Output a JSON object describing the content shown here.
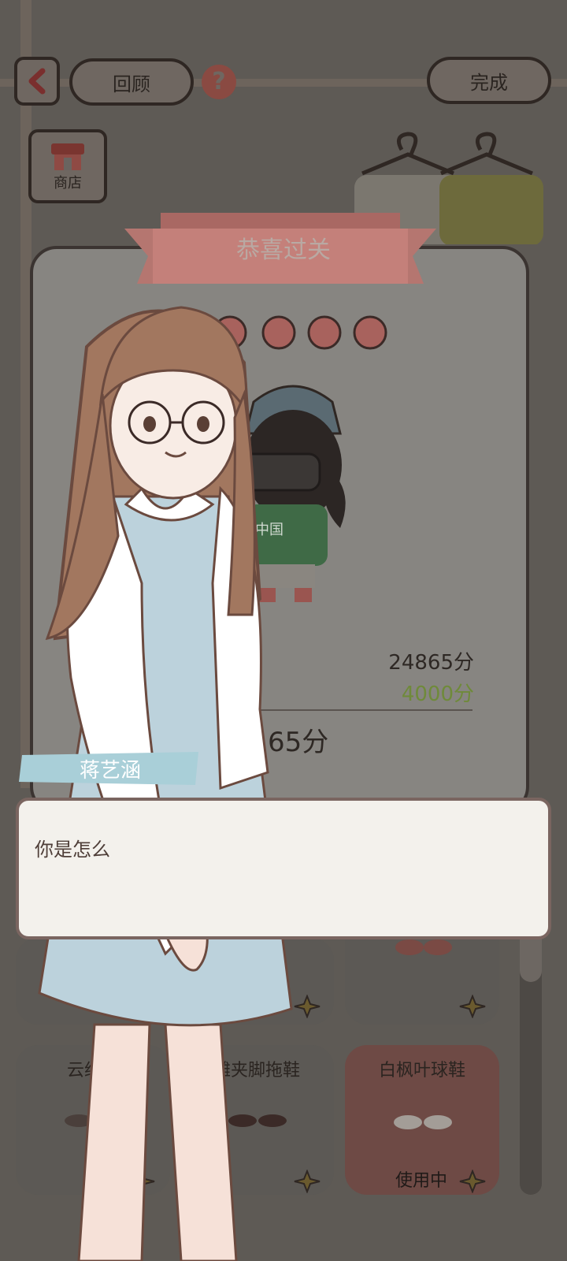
{
  "header": {
    "back_icon": "chevron-left-icon",
    "review_label": "回顾",
    "help_icon": "question-icon",
    "done_label": "完成"
  },
  "shop": {
    "label": "商店",
    "icon": "shop-awning-icon"
  },
  "result": {
    "title": "恭喜过关",
    "stars_total": 5,
    "score_main": "24865分",
    "score_bonus": "4000分",
    "score_total_partial": "65分",
    "character_shirt_text": "中国"
  },
  "dialog": {
    "speaker": "蒋艺涵",
    "text": "你是怎么"
  },
  "shoes": {
    "items": [
      {
        "label": "云纱布",
        "icon": "shoe-icon"
      },
      {
        "label": "滩夹脚拖鞋",
        "icon": "sandal-icon"
      },
      {
        "label": "白枫叶球鞋",
        "icon": "sneaker-icon",
        "status": "使用中"
      }
    ]
  },
  "colors": {
    "accent": "#c4706a",
    "bonus_green": "#6f8a3a",
    "panel_border": "#3b3431",
    "dialog_bg": "#f3f1ec"
  }
}
